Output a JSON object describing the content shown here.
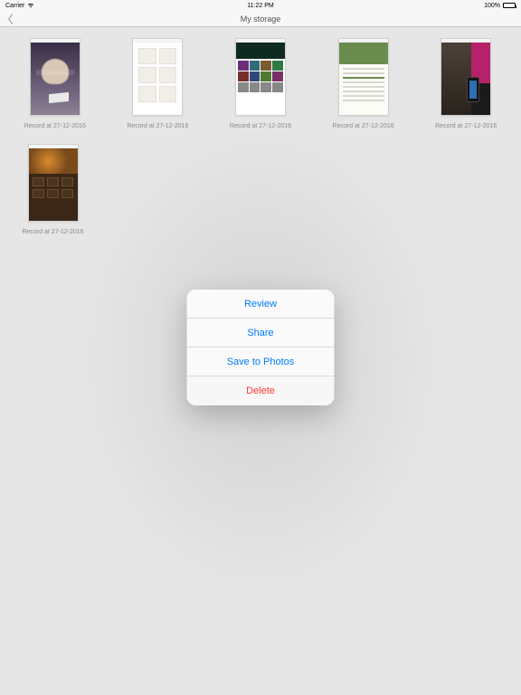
{
  "status": {
    "carrier": "Carrier",
    "time": "11:22 PM",
    "battery_pct": "100%"
  },
  "nav": {
    "title": "My storage"
  },
  "grid": {
    "items": [
      {
        "caption": "Record at 27-12-2016"
      },
      {
        "caption": "Record at 27-12-2016"
      },
      {
        "caption": "Record at 27-12-2016"
      },
      {
        "caption": "Record at 27-12-2016"
      },
      {
        "caption": "Record at 27-12-2016"
      },
      {
        "caption": "Record at 27-12-2016"
      }
    ]
  },
  "sheet": {
    "review": "Review",
    "share": "Share",
    "save": "Save to Photos",
    "delete": "Delete"
  }
}
